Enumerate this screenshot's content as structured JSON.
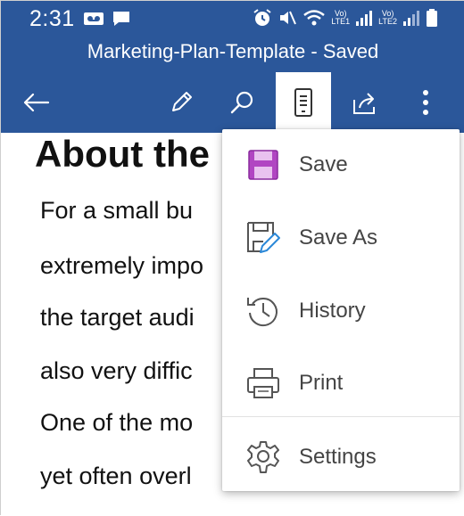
{
  "status_bar": {
    "time": "2:31",
    "sim1_top": "Vo)",
    "sim1_bottom": "LTE1",
    "sim2_top": "Vo)",
    "sim2_bottom": "LTE2"
  },
  "header": {
    "title": "Marketing-Plan-Template - Saved"
  },
  "toolbar": {
    "icons": [
      "back-arrow-icon",
      "pencil-icon",
      "search-icon",
      "mobile-view-icon",
      "share-icon",
      "more-vertical-icon"
    ],
    "active": "mobile-view-icon"
  },
  "document": {
    "heading": "About the",
    "lines": [
      "For a small bu",
      "extremely impo",
      "the target audi",
      "also very diffic",
      "One of the mo",
      "yet often overl"
    ]
  },
  "menu": {
    "items": [
      {
        "label": "Save",
        "icon": "save-icon"
      },
      {
        "label": "Save As",
        "icon": "save-as-icon"
      },
      {
        "label": "History",
        "icon": "history-icon"
      },
      {
        "label": "Print",
        "icon": "print-icon"
      },
      {
        "label": "Settings",
        "icon": "settings-icon"
      }
    ]
  },
  "colors": {
    "header_bg": "#2b579a",
    "save_icon": "#b146c2",
    "save_as_pen": "#2b88d8"
  }
}
